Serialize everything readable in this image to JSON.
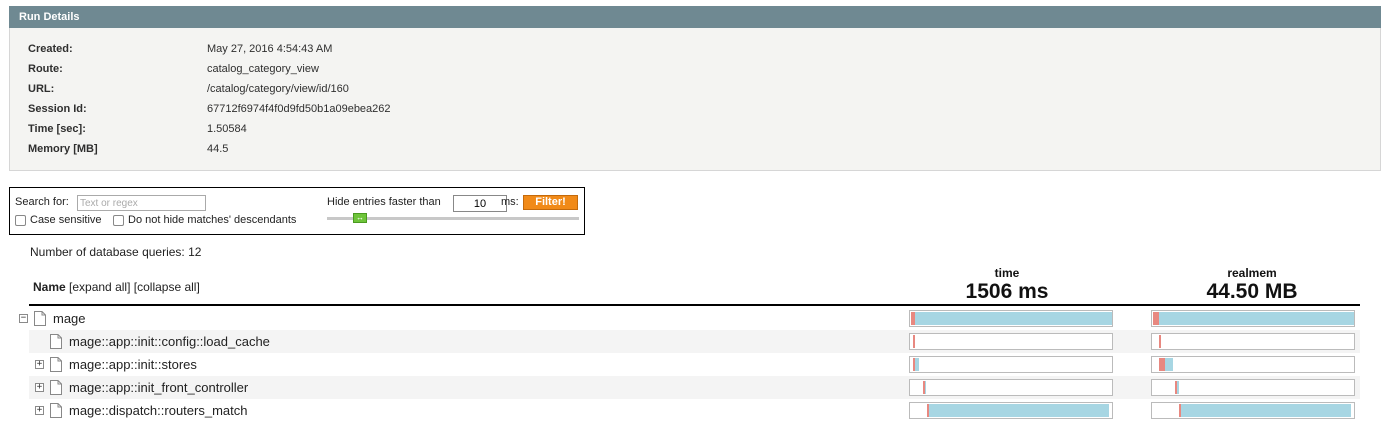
{
  "run_details": {
    "title": "Run Details",
    "fields": [
      {
        "key": "Created:",
        "value": "May 27, 2016 4:54:43 AM"
      },
      {
        "key": "Route:",
        "value": "catalog_category_view"
      },
      {
        "key": "URL:",
        "value": "/catalog/category/view/id/160"
      },
      {
        "key": "Session Id:",
        "value": "67712f6974f4f0d9fd50b1a09ebea262"
      },
      {
        "key": "Time [sec]:",
        "value": "1.50584"
      },
      {
        "key": "Memory [MB]",
        "value": "44.5"
      }
    ]
  },
  "filter": {
    "search_label": "Search for:",
    "search_placeholder": "Text or regex",
    "case_sensitive_label": "Case sensitive",
    "descendants_label": "Do not hide matches' descendants",
    "hide_label": "Hide entries faster than",
    "ms_value": "10",
    "ms_label": "ms:",
    "filter_button": "Filter!",
    "slider_handle_glyph": "↔"
  },
  "db_queries": "Number of database queries: 12",
  "tree": {
    "name_header": "Name",
    "expand_all": "[expand all]",
    "collapse_all": "[collapse all]",
    "time_title": "time",
    "time_total": "1506 ms",
    "mem_title": "realmem",
    "mem_total": "44.50 MB",
    "rows": [
      {
        "label": "mage",
        "toggle": "−",
        "time": {
          "start": 0,
          "total": 1.0,
          "own": 0.02
        },
        "mem": {
          "start": 0,
          "total": 1.0,
          "own": 0.03
        }
      },
      {
        "label": "mage::app::init::config::load_cache",
        "toggle": "",
        "time": {
          "start": 0.01,
          "total": 0.0,
          "own": 0.01
        },
        "mem": {
          "start": 0.03,
          "total": 0.0,
          "own": 0.01
        }
      },
      {
        "label": "mage::app::init::stores",
        "toggle": "+",
        "time": {
          "start": 0.01,
          "total": 0.03,
          "own": 0.01
        },
        "mem": {
          "start": 0.03,
          "total": 0.07,
          "own": 0.03
        }
      },
      {
        "label": "mage::app::init_front_controller",
        "toggle": "+",
        "time": {
          "start": 0.06,
          "total": 0.015,
          "own": 0.01
        },
        "mem": {
          "start": 0.11,
          "total": 0.02,
          "own": 0.01
        }
      },
      {
        "label": "mage::dispatch::routers_match",
        "toggle": "+",
        "time": {
          "start": 0.08,
          "total": 0.9,
          "own": 0.01
        },
        "mem": {
          "start": 0.13,
          "total": 0.85,
          "own": 0.01
        }
      }
    ]
  },
  "colors": {
    "header_bg": "#6f8992",
    "bar_fill": "#a7d6e3",
    "bar_own": "#e88880",
    "filter_button": "#f18a18",
    "slider_handle": "#6ec43a"
  }
}
